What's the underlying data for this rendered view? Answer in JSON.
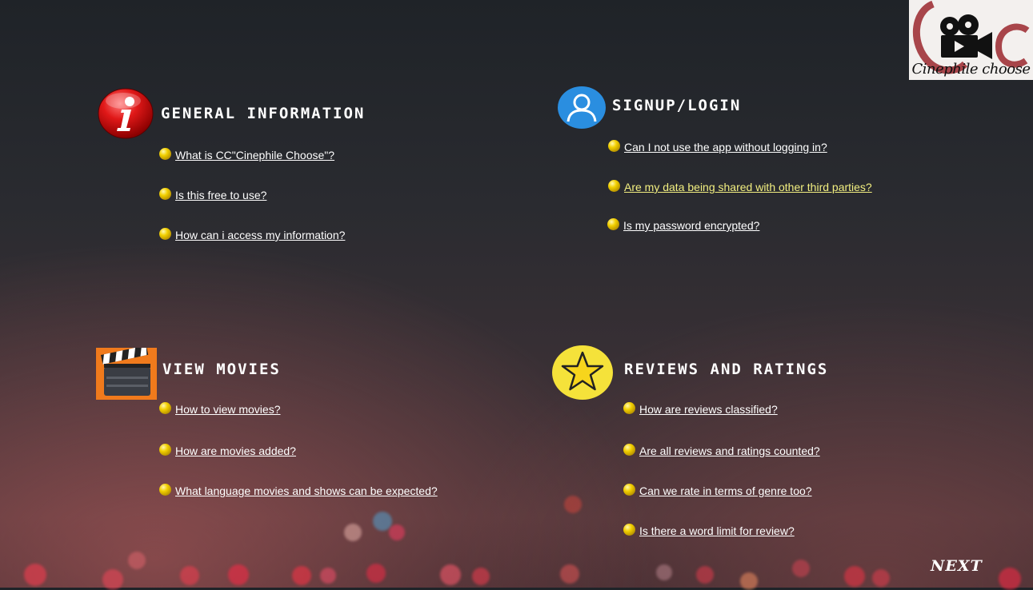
{
  "logo": {
    "text": "Cinephile choose",
    "brand_color": "#a8454a"
  },
  "sections": {
    "general": {
      "title": "GENERAL INFORMATION",
      "icon": "info-icon",
      "items": [
        "What is CC\"Cinephile Choose\"?",
        "Is this free to use?",
        "How can i access my information?"
      ]
    },
    "signup": {
      "title": "SIGNUP/LOGIN",
      "icon": "user-icon",
      "items": [
        "Can I not use the app without logging in?",
        "Are my data being shared with other third parties?",
        "Is my password encrypted?"
      ]
    },
    "movies": {
      "title": "VIEW MOVIES",
      "icon": "clapperboard-icon",
      "items": [
        "How to view movies?",
        "How are movies added?",
        "What language movies and shows can be expected?"
      ]
    },
    "reviews": {
      "title": "REVIEWS AND RATINGS",
      "icon": "star-icon",
      "items": [
        "How are reviews classified?",
        "Are all reviews and ratings counted?",
        "Can we rate in terms of genre too?",
        "Is there a word limit for review?"
      ]
    }
  },
  "next_label": "NEXT",
  "colors": {
    "link": "#ffffff",
    "link_highlight": "#f3ef80",
    "bullet": "#f2d000",
    "title": "#ffffff"
  }
}
